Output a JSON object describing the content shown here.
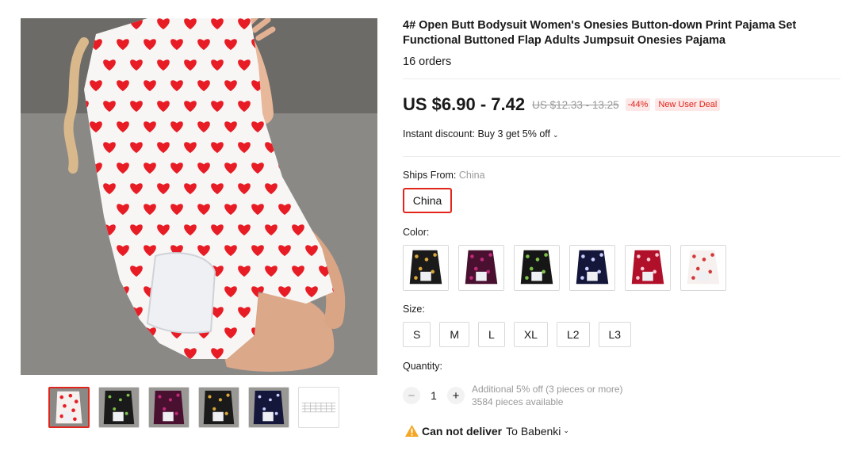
{
  "product": {
    "title": "4# Open Butt Bodysuit Women's Onesies Button-down Print Pajama Set Functional Buttoned Flap Adults Jumpsuit Onesies Pajama",
    "orders": "16 orders"
  },
  "pricing": {
    "price": "US $6.90 - 7.42",
    "original": "US $12.33 - 13.25",
    "discount": "-44%",
    "deal_badge": "New User Deal",
    "instant_discount": "Instant discount: Buy 3 get 5% off"
  },
  "shipping": {
    "label": "Ships From:",
    "value": "China",
    "option": "China"
  },
  "color": {
    "label": "Color:",
    "swatches": [
      {
        "name": "black-gold-hearts",
        "base": "#1a1a1a",
        "print": "#d9a63a"
      },
      {
        "name": "purple-hearts",
        "base": "#4a1030",
        "print": "#c02a7a"
      },
      {
        "name": "black-green-print",
        "base": "#161616",
        "print": "#7ec24a"
      },
      {
        "name": "navy-hearts",
        "base": "#14163a",
        "print": "#c9d0ff"
      },
      {
        "name": "red-print",
        "base": "#b0102a",
        "print": "#f7c8d4"
      },
      {
        "name": "white-red-hearts",
        "base": "#f6f0ee",
        "print": "#d23a3a"
      }
    ]
  },
  "size": {
    "label": "Size:",
    "options": [
      "S",
      "M",
      "L",
      "XL",
      "L2",
      "L3"
    ]
  },
  "quantity": {
    "label": "Quantity:",
    "minus": "−",
    "value": "1",
    "plus": "+",
    "note1": "Additional 5% off (3 pieces or more)",
    "note2": "3584 pieces available"
  },
  "delivery": {
    "status": "Can not deliver",
    "destination": "To Babenki"
  },
  "colors": {
    "accent": "#e1251b",
    "heart": "#e81c24",
    "warning": "#f5a623"
  }
}
